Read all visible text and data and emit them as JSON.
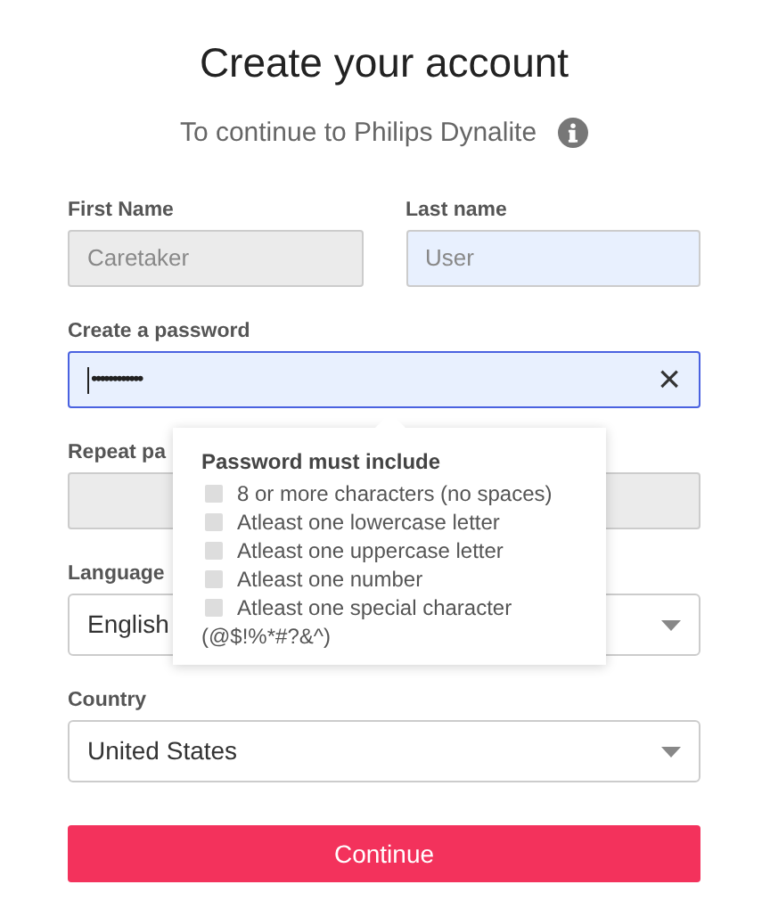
{
  "title": "Create your account",
  "subtitle": "To continue to Philips Dynalite",
  "name_fields": [
    {
      "label": "First Name",
      "value": "Caretaker",
      "disabled": true,
      "autofilled": false
    },
    {
      "label": "Last name",
      "value": "User",
      "disabled": false,
      "autofilled": true
    }
  ],
  "password": {
    "label": "Create a password",
    "value": "••••••••••••",
    "autofilled": true,
    "focused": true,
    "clear": "×"
  },
  "repeat_password": {
    "label": "Repeat pa",
    "disabled": true
  },
  "selects": [
    {
      "label": "Language",
      "value": "English"
    },
    {
      "label": "Country",
      "value": "United States"
    }
  ],
  "popup": {
    "title": "Password must include",
    "rules": [
      {
        "text": "8 or more characters (no spaces)",
        "checked": false
      },
      {
        "text": "Atleast one lowercase letter",
        "checked": false
      },
      {
        "text": "Atleast one uppercase letter",
        "checked": false
      },
      {
        "text": "Atleast one number",
        "checked": false
      },
      {
        "text": "Atleast one special character",
        "checked": false
      }
    ],
    "note": "(@$!%*#?&^)"
  },
  "button": "Continue"
}
